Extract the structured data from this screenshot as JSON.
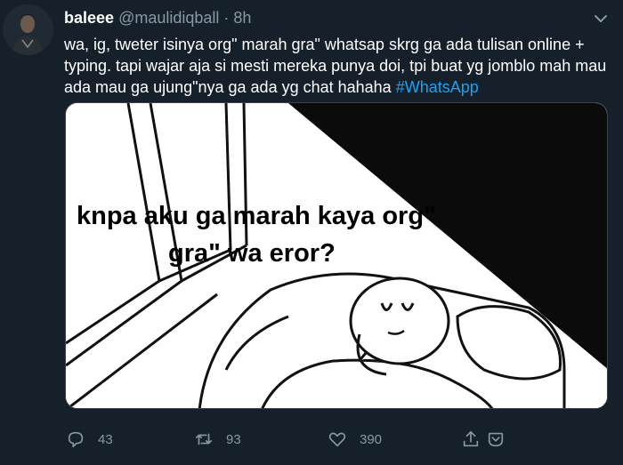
{
  "author": {
    "display_name": "baleee",
    "handle": "@maulidiqball",
    "separator": "·",
    "time": "8h"
  },
  "tweet": {
    "text": "wa, ig, tweter isinya org\" marah gra\" whatsap skrg ga ada tulisan online + typing. tapi wajar aja si mesti mereka punya doi, tpi buat yg jomblo mah mau ada mau ga ujung\"nya ga ada yg chat hahaha ",
    "hashtag": "#WhatsApp"
  },
  "media": {
    "caption_line1": "knpa aku ga marah kaya org\"",
    "caption_line2": "gra\" wa eror?"
  },
  "actions": {
    "reply_count": "43",
    "retweet_count": "93",
    "like_count": "390"
  },
  "icons": {
    "reply": "reply-icon",
    "retweet": "retweet-icon",
    "like": "heart-icon",
    "share": "share-icon",
    "more": "chevron-down-icon"
  },
  "colors": {
    "background": "#15202b",
    "secondary_text": "#8899a6",
    "accent": "#1da1f2",
    "border": "#38444d"
  }
}
